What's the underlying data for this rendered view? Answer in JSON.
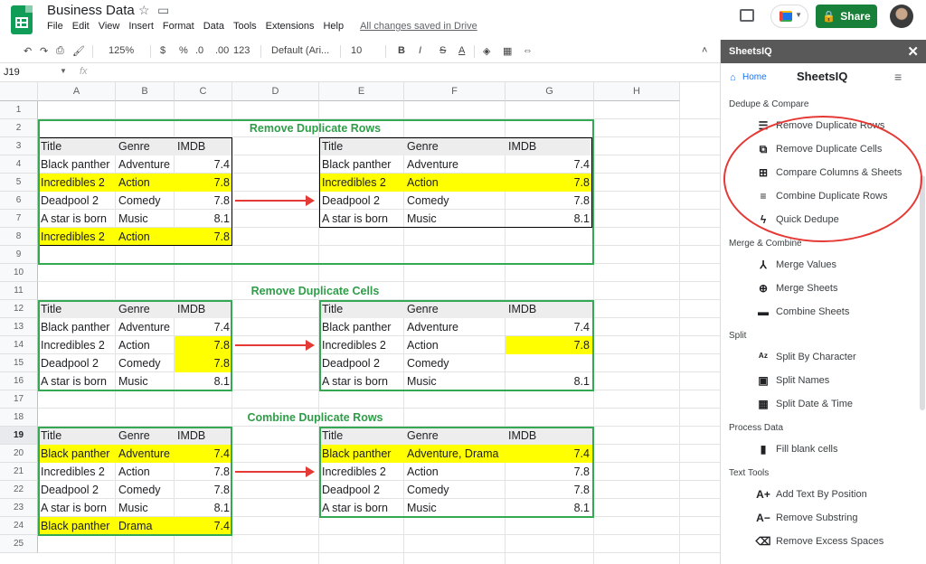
{
  "doc": {
    "title": "Business Data",
    "saved": "All changes saved in Drive"
  },
  "menu": [
    "File",
    "Edit",
    "View",
    "Insert",
    "Format",
    "Data",
    "Tools",
    "Extensions",
    "Help"
  ],
  "share_label": "Share",
  "toolbar": {
    "zoom": "125%",
    "currency": "$",
    "percent": "%",
    "dec_less": ".0",
    "dec_more": ".00",
    "format": "123",
    "font": "Default (Ari...",
    "size": "10",
    "bold": "B",
    "italic": "I",
    "strike": "S",
    "textcolor": "A"
  },
  "namebox": "J19",
  "fx": "fx",
  "columns": [
    "A",
    "B",
    "C",
    "D",
    "E",
    "F",
    "G",
    "H"
  ],
  "rows": [
    "1",
    "2",
    "3",
    "4",
    "5",
    "6",
    "7",
    "8",
    "9",
    "10",
    "11",
    "12",
    "13",
    "14",
    "15",
    "16",
    "17",
    "18",
    "19",
    "20",
    "21",
    "22",
    "23",
    "24",
    "25"
  ],
  "sections": [
    {
      "title": "Remove Duplicate Rows"
    },
    {
      "title": "Remove Duplicate Cells"
    },
    {
      "title": "Combine Duplicate Rows"
    }
  ],
  "headers": [
    "Title",
    "Genre",
    "IMDB"
  ],
  "sec1_left": [
    [
      "Black panther",
      "Adventure",
      "7.4"
    ],
    [
      "Incredibles 2",
      "Action",
      "7.8"
    ],
    [
      "Deadpool 2",
      "Comedy",
      "7.8"
    ],
    [
      "A star is born",
      "Music",
      "8.1"
    ],
    [
      "Incredibles 2",
      "Action",
      "7.8"
    ]
  ],
  "sec1_right": [
    [
      "Black panther",
      "Adventure",
      "7.4"
    ],
    [
      "Incredibles 2",
      "Action",
      "7.8"
    ],
    [
      "Deadpool 2",
      "Comedy",
      "7.8"
    ],
    [
      "A star is born",
      "Music",
      "8.1"
    ]
  ],
  "sec2_left": [
    [
      "Black panther",
      "Adventure",
      "7.4"
    ],
    [
      "Incredibles 2",
      "Action",
      "7.8"
    ],
    [
      "Deadpool 2",
      "Comedy",
      "7.8"
    ],
    [
      "A star is born",
      "Music",
      "8.1"
    ]
  ],
  "sec2_right": [
    [
      "Black panther",
      "Adventure",
      "7.4"
    ],
    [
      "Incredibles 2",
      "Action",
      "7.8"
    ],
    [
      "Deadpool 2",
      "Comedy",
      ""
    ],
    [
      "A star is born",
      "Music",
      "8.1"
    ]
  ],
  "sec3_left": [
    [
      "Black panther",
      "Adventure",
      "7.4"
    ],
    [
      "Incredibles 2",
      "Action",
      "7.8"
    ],
    [
      "Deadpool 2",
      "Comedy",
      "7.8"
    ],
    [
      "A star is born",
      "Music",
      "8.1"
    ],
    [
      "Black panther",
      "Drama",
      "7.4"
    ]
  ],
  "sec3_right": [
    [
      "Black panther",
      "Adventure, Drama",
      "7.4"
    ],
    [
      "Incredibles 2",
      "Action",
      "7.8"
    ],
    [
      "Deadpool 2",
      "Comedy",
      "7.8"
    ],
    [
      "A star is born",
      "Music",
      "8.1"
    ]
  ],
  "sidebar": {
    "header": "SheetsIQ",
    "home": "Home",
    "brand": "SheetsIQ",
    "categories": [
      {
        "label": "Dedupe & Compare",
        "items": [
          {
            "label": "Remove Duplicate Rows",
            "icon": "rows-icon"
          },
          {
            "label": "Remove Duplicate Cells",
            "icon": "copy-icon"
          },
          {
            "label": "Compare Columns & Sheets",
            "icon": "table-icon"
          },
          {
            "label": "Combine Duplicate Rows",
            "icon": "merge-check-icon"
          },
          {
            "label": "Quick Dedupe",
            "icon": "bolt-icon"
          }
        ]
      },
      {
        "label": "Merge & Combine",
        "items": [
          {
            "label": "Merge Values",
            "icon": "merge-icon"
          },
          {
            "label": "Merge Sheets",
            "icon": "add-sheet-icon"
          },
          {
            "label": "Combine Sheets",
            "icon": "folder-icon"
          }
        ]
      },
      {
        "label": "Split",
        "items": [
          {
            "label": "Split By Character",
            "icon": "az-icon"
          },
          {
            "label": "Split Names",
            "icon": "id-icon"
          },
          {
            "label": "Split Date & Time",
            "icon": "calendar-icon"
          }
        ]
      },
      {
        "label": "Process Data",
        "items": [
          {
            "label": "Fill blank cells",
            "icon": "paint-roller-icon"
          }
        ]
      },
      {
        "label": "Text Tools",
        "items": [
          {
            "label": "Add Text By Position",
            "icon": "a-plus-icon"
          },
          {
            "label": "Remove Substring",
            "icon": "a-minus-icon"
          },
          {
            "label": "Remove Excess Spaces",
            "icon": "backspace-icon"
          }
        ]
      }
    ]
  }
}
